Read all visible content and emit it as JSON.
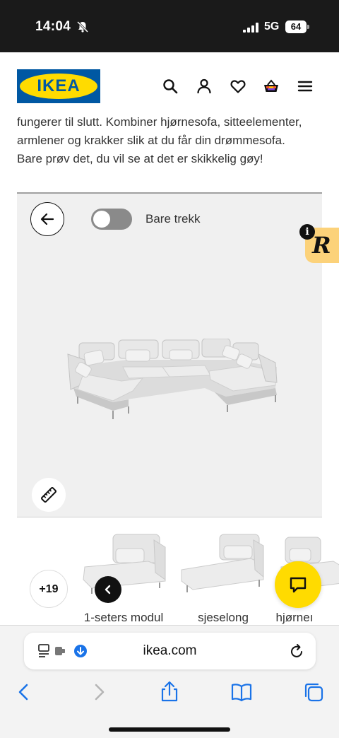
{
  "status_bar": {
    "time": "14:04",
    "network": "5G",
    "battery": "64"
  },
  "header": {
    "logo_text": "IKEA",
    "icons": [
      "search-icon",
      "account-icon",
      "heart-icon",
      "cart-icon",
      "menu-icon"
    ]
  },
  "intro": {
    "line1": "fungerer til slutt. Kombiner hjørnesofa, sitteelementer,",
    "line2": "armlener og krakker slik at du får din drømmesofa.",
    "line3": "Bare prøv det, du vil se at det er skikkelig gøy!"
  },
  "configurator": {
    "toggle_label": "Bare trekk",
    "toggle_on": false
  },
  "badge": {
    "info": "i",
    "letter": "R"
  },
  "modules": {
    "more_count": "+19",
    "items": [
      {
        "label": "1-seters modul"
      },
      {
        "label": "sjeselong"
      },
      {
        "label": "hjørneı"
      }
    ]
  },
  "browser": {
    "url": "ikea.com"
  },
  "colors": {
    "ikea_blue": "#0058a3",
    "ikea_yellow": "#ffdb00",
    "badge_bg": "#fcd27a",
    "panel_bg": "#f0f0f0"
  }
}
